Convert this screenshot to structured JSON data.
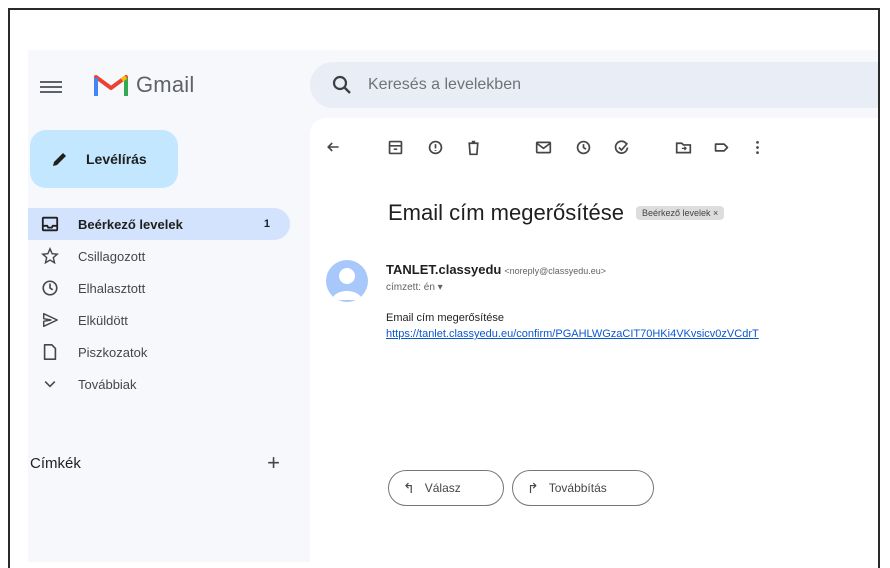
{
  "app": {
    "name": "Gmail"
  },
  "search": {
    "placeholder": "Keresés a levelekben"
  },
  "compose": {
    "label": "Levélírás"
  },
  "sidebar": {
    "items": [
      {
        "label": "Beérkező levelek",
        "count": "1"
      },
      {
        "label": "Csillagozott"
      },
      {
        "label": "Elhalasztott"
      },
      {
        "label": "Elküldött"
      },
      {
        "label": "Piszkozatok"
      },
      {
        "label": "Továbbiak"
      }
    ],
    "labels_title": "Címkék",
    "labels_add": "+"
  },
  "email": {
    "subject": "Email cím megerősítése",
    "folder_chip": "Beérkező levelek ×",
    "sender_name": "TANLET.classyedu",
    "sender_address": "<noreply@classyedu.eu>",
    "to": "címzett: én ▾",
    "body_line": "Email cím megerősítése",
    "link": "https://tanlet.classyedu.eu/confirm/PGAHLWGzaCIT70HKi4VKvsicv0zVCdrT"
  },
  "actions": {
    "reply": "Válasz",
    "forward": "Továbbítás"
  },
  "colors": {
    "accent": "#c2e7ff",
    "active_nav": "#d3e3fd",
    "link": "#0b57d0",
    "bg": "#f6f8fc"
  }
}
